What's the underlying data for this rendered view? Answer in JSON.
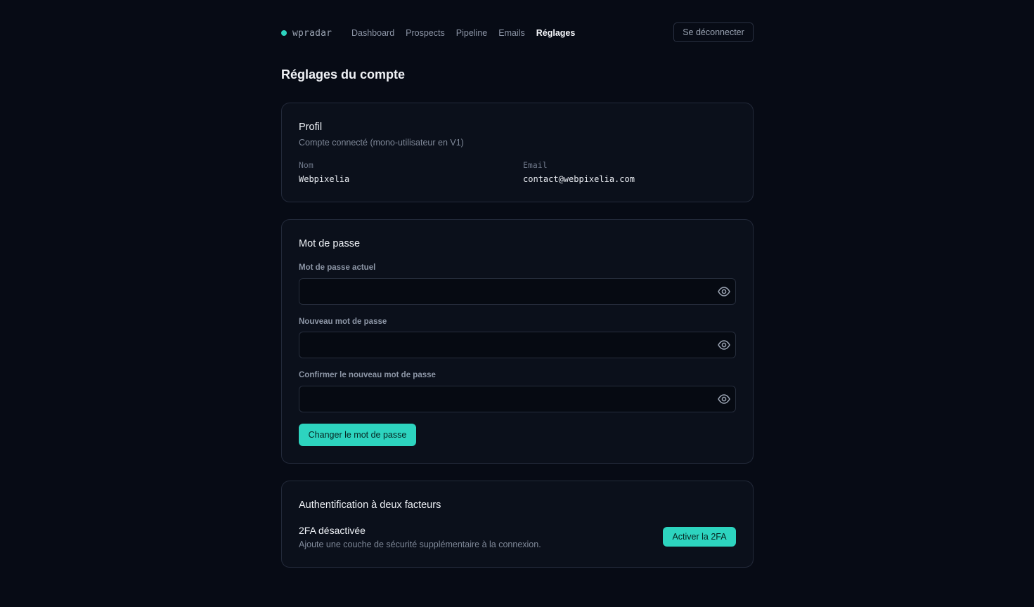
{
  "brand": {
    "name": "wpradar",
    "accent": "#2dd4bf"
  },
  "nav": {
    "items": [
      {
        "label": "Dashboard"
      },
      {
        "label": "Prospects"
      },
      {
        "label": "Pipeline"
      },
      {
        "label": "Emails"
      },
      {
        "label": "Réglages",
        "active": true
      }
    ],
    "logout_label": "Se déconnecter"
  },
  "page": {
    "title": "Réglages du compte"
  },
  "profile": {
    "title": "Profil",
    "subtitle": "Compte connecté (mono-utilisateur en V1)",
    "name_label": "Nom",
    "name_value": "Webpixelia",
    "email_label": "Email",
    "email_value": "contact@webpixelia.com"
  },
  "password": {
    "title": "Mot de passe",
    "current_label": "Mot de passe actuel",
    "current_value": "",
    "new_label": "Nouveau mot de passe",
    "new_value": "",
    "confirm_label": "Confirmer le nouveau mot de passe",
    "confirm_value": "",
    "submit_label": "Changer le mot de passe",
    "toggle_icon": "eye-icon"
  },
  "two_factor": {
    "title": "Authentification à deux facteurs",
    "status": "2FA désactivée",
    "description": "Ajoute une couche de sécurité supplémentaire à la connexion.",
    "button_label": "Activer la 2FA"
  }
}
